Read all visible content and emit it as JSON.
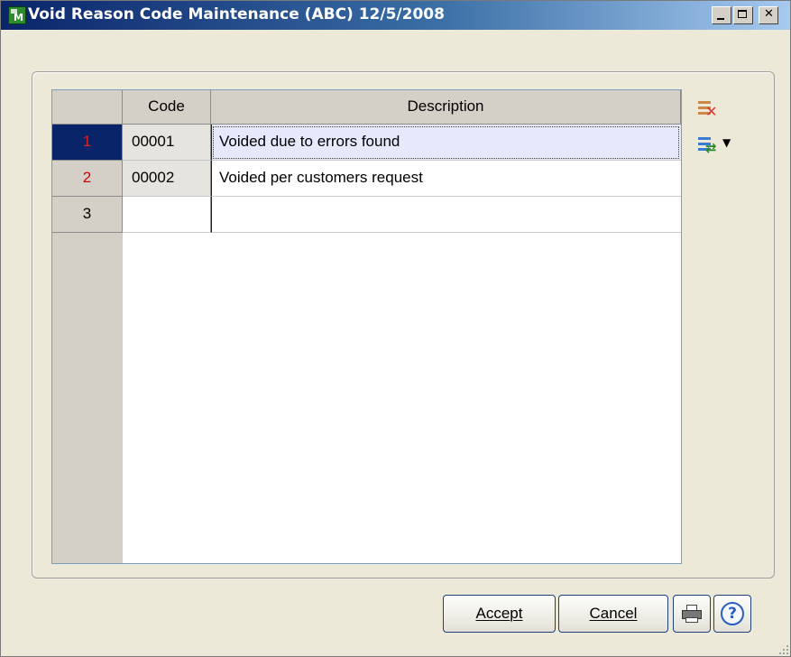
{
  "window": {
    "title": "Void Reason Code Maintenance (ABC) 12/5/2008"
  },
  "grid": {
    "columns": [
      "",
      "Code",
      "Description"
    ],
    "rows": [
      {
        "num": "1",
        "code": "00001",
        "description": "Voided due to errors found",
        "selected": true
      },
      {
        "num": "2",
        "code": "00002",
        "description": "Voided per customers request",
        "selected": false
      },
      {
        "num": "3",
        "code": "",
        "description": "",
        "selected": false
      }
    ]
  },
  "side_toolbar": {
    "icons": [
      "delete-row-icon",
      "switch-view-icon",
      "dropdown-arrow-icon"
    ]
  },
  "buttons": {
    "accept_label": "Accept",
    "cancel_label": "Cancel"
  },
  "colors": {
    "title_bar_start": "#0a246a",
    "selected_row_header": "#0a246a",
    "row_number_red": "#d00000",
    "active_cell": "#e6e8fc"
  }
}
